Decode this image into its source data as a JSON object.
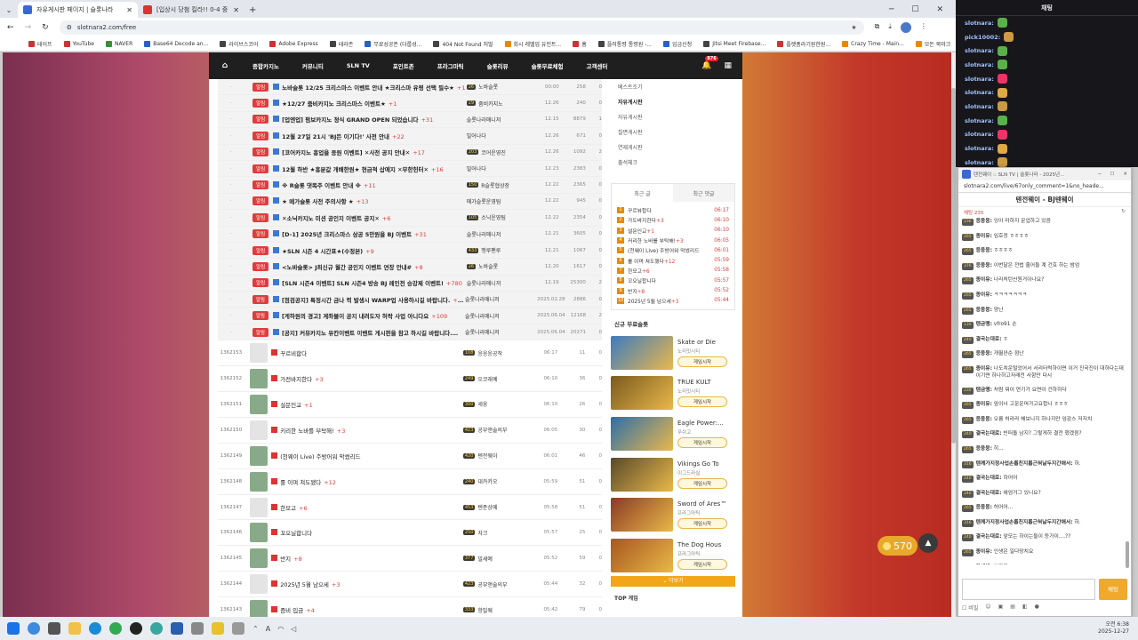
{
  "browser": {
    "tabs": [
      {
        "title": "자유게시판 페이지 | 슬롯나라",
        "active": true
      },
      {
        "title": "[입상시 당첨 킬라!! 0-4 중하드",
        "active": false
      }
    ],
    "url": "slotnara2.com/free",
    "bookmarks": [
      "테이프",
      "YouTube",
      "NAVER",
      "Base64 Decode an...",
      "라이브스코어",
      "Adobe Express",
      "테라존",
      "무료성공존 (다룹성...",
      "404 Not Found 처벌",
      "회시 레벨업 유인트...",
      "홈",
      "플러통령 통령원 -...",
      "입금신청",
      "Jitsi Meet Firebase...",
      "플랫폼라기원한원...",
      "Crazy Time - Main...",
      "모든 북마크"
    ]
  },
  "site": {
    "nav": [
      "종합카지노",
      "커뮤니티",
      "SLN TV",
      "포인트존",
      "프라그마틱",
      "슬롯리뷰",
      "슬롯무료체험",
      "고객센터"
    ],
    "bell_count": "876",
    "notice_label": "알림",
    "notices": [
      {
        "subject": "노바슬롯 12/25 크리스마스 이벤트 안내 ★크리스마 유령 선택 필수★",
        "comments": "+1",
        "lv": "26",
        "author": "노바슬롯",
        "date": "00:00",
        "views": "258",
        "likes": "0"
      },
      {
        "subject": "★12/27 줌비카지노 크리스마스 이벤트★",
        "comments": "+1",
        "lv": "29",
        "author": "줌비카지노",
        "date": "12.26",
        "views": "240",
        "likes": "0"
      },
      {
        "subject": "[업엔업] 펌보카지노 정식 GRAND OPEN 되었습니다",
        "comments": "+31",
        "lv": "",
        "author": "슬롯나라매니저",
        "date": "12.15",
        "views": "8879",
        "likes": "1"
      },
      {
        "subject": "12월 27일 21시 'BJ든 이기다!' 사전 안내",
        "comments": "+22",
        "lv": "",
        "author": "밀어나다",
        "date": "12.26",
        "views": "671",
        "likes": "0"
      },
      {
        "subject": "[코어카지노 흥업을 응원 이벤트] ✕사전 공지 안내✕",
        "comments": "+17",
        "lv": "203",
        "author": "코어운영진",
        "date": "12.26",
        "views": "1092",
        "likes": "2"
      },
      {
        "subject": "12월 하반 ★흥분값 개배한원★ 현금적 삽에지 ✕무한헌터✕",
        "comments": "+16",
        "lv": "",
        "author": "밀어나다",
        "date": "12.23",
        "views": "2383",
        "likes": "0"
      },
      {
        "subject": "※ R슬롯 댓목주 이벤트 안내 ※",
        "comments": "+11",
        "lv": "150",
        "author": "R슬롯협상장",
        "date": "12.22",
        "views": "2365",
        "likes": "0"
      },
      {
        "subject": "★ 메가슬롯 사전 주의사항 ★",
        "comments": "+13",
        "lv": "",
        "author": "메가슬롯운영팀",
        "date": "12.22",
        "views": "945",
        "likes": "0"
      },
      {
        "subject": "✕소닉카지노 미션 공인지 이벤트 공지✕",
        "comments": "+6",
        "lv": "105",
        "author": "소닉운영팀",
        "date": "12.22",
        "views": "2354",
        "likes": "0"
      },
      {
        "subject": "[D-1] 2025년 크리스마스 삼공 5만원을 BJ 이벤트",
        "comments": "+31",
        "lv": "",
        "author": "슬롯나라매니저",
        "date": "12.21",
        "views": "3605",
        "likes": "0"
      },
      {
        "subject": "★SLN 시즌 4 시간표★(수정본)",
        "comments": "+9",
        "lv": "433",
        "author": "맹루팬루",
        "date": "12.21",
        "views": "1067",
        "likes": "0"
      },
      {
        "subject": "<노바슬롯> J최신규 월간 공인지 이벤트 연장 안내#",
        "comments": "+8",
        "lv": "26",
        "author": "노바슬롯",
        "date": "12.20",
        "views": "1617",
        "likes": "0"
      },
      {
        "subject": "[SLN 시즌4 이벤트] SLN 시즌4 방송 BJ 레인전 승강제 이벤트!",
        "comments": "+780",
        "lv": "",
        "author": "슬롯나라매니저",
        "date": "12.19",
        "views": "25300",
        "likes": "2"
      },
      {
        "subject": "[점검공지] 특정시간 금나 력 발생시 WARP업 사용하시길 바랍니다.",
        "comments": "+34",
        "lv": "",
        "author": "슬롯나라매니저",
        "date": "2025.02.28",
        "views": "2886",
        "likes": "0"
      },
      {
        "subject": "[게하원의 경고] 계좌불이 공지 내려도자 허락 사업 아니다요",
        "comments": "+109",
        "lv": "",
        "author": "슬롯나라매니저",
        "date": "2025.06.04",
        "views": "12168",
        "likes": "2"
      },
      {
        "subject": "[공지] 커뮤카지노 유칸이벤트 이벤트 게시판을 참고 하시길 바랍니다.",
        "comments": "+22",
        "lv": "",
        "author": "슬롯나라매니저",
        "date": "2025.06.04",
        "views": "20271",
        "likes": "0"
      }
    ],
    "posts": [
      {
        "num": "1362153",
        "subject": "꾸르비합다",
        "comments": "",
        "lv": "108",
        "author": "응응응공작",
        "date": "06:17",
        "views": "11",
        "likes": "0"
      },
      {
        "num": "1362152",
        "subject": "가전바지한다",
        "comments": "+3",
        "lv": "249",
        "author": "오코래예",
        "date": "06:10",
        "views": "36",
        "likes": "0"
      },
      {
        "num": "1362151",
        "subject": "설문인교",
        "comments": "+1",
        "lv": "300",
        "author": "세웅",
        "date": "06:10",
        "views": "26",
        "likes": "0"
      },
      {
        "num": "1362150",
        "subject": "키리한 노바를 부탁해!",
        "comments": "+3",
        "lv": "423",
        "author": "공부앤술의부",
        "date": "06:05",
        "views": "30",
        "likes": "0"
      },
      {
        "num": "1362149",
        "subject": "(천웨이 Live) 주방어워 막썼리드",
        "comments": "",
        "lv": "420",
        "author": "텐전웨이",
        "date": "06:01",
        "views": "46",
        "likes": "0"
      },
      {
        "num": "1362148",
        "subject": "롤 이며 쳐도됐다",
        "comments": "+12",
        "lv": "240",
        "author": "대카카오",
        "date": "05:59",
        "views": "51",
        "likes": "0"
      },
      {
        "num": "1362147",
        "subject": "한모고",
        "comments": "+6",
        "lv": "453",
        "author": "텐준상메",
        "date": "05:58",
        "views": "51",
        "likes": "0"
      },
      {
        "num": "1362146",
        "subject": "꼬오닐합니다",
        "comments": "",
        "lv": "250",
        "author": "자크",
        "date": "05:57",
        "views": "25",
        "likes": "0"
      },
      {
        "num": "1362145",
        "subject": "반지",
        "comments": "+8",
        "lv": "377",
        "author": "밀셰예",
        "date": "05:52",
        "views": "59",
        "likes": "0"
      },
      {
        "num": "1362144",
        "subject": "2025년 5월 남으세",
        "comments": "+3",
        "lv": "423",
        "author": "공부앤술의부",
        "date": "05:44",
        "views": "32",
        "likes": "0"
      },
      {
        "num": "1362143",
        "subject": "즘비 입금",
        "comments": "+4",
        "lv": "333",
        "author": "항빌웨",
        "date": "05:42",
        "views": "79",
        "likes": "0"
      }
    ],
    "sidemenu": [
      "베스트조기",
      "자유게시판",
      "자유게시판",
      "칠면게시판",
      "연재게시판",
      "출석체크"
    ],
    "rank_tabs": [
      "최근 글",
      "최근 댓글"
    ],
    "rank": [
      {
        "n": "1",
        "t": "꾸르뷰합다",
        "c": "",
        "time": "06:17"
      },
      {
        "n": "2",
        "t": "가도바지한다",
        "c": "+3",
        "time": "06:10"
      },
      {
        "n": "3",
        "t": "설문인교",
        "c": "+1",
        "time": "06:10"
      },
      {
        "n": "4",
        "t": "커리한 노바를 부탁해!",
        "c": "+3",
        "time": "06:05"
      },
      {
        "n": "5",
        "t": "(천웨이 Live) 주방어워 막썼리드",
        "c": "",
        "time": "06:01"
      },
      {
        "n": "6",
        "t": "롤 이며 쳐도됐다",
        "c": "+12",
        "time": "05:59"
      },
      {
        "n": "7",
        "t": "한모고",
        "c": "+6",
        "time": "05:58"
      },
      {
        "n": "8",
        "t": "꼬오닐합니다",
        "c": "",
        "time": "05:57"
      },
      {
        "n": "9",
        "t": "반지",
        "c": "+8",
        "time": "05:52"
      },
      {
        "n": "10",
        "t": "2025년 5월 남으세",
        "c": "+3",
        "time": "05:44"
      }
    ],
    "games_header": "신규 무료슬롯",
    "games": [
      {
        "name": "Skate or Die",
        "provider": "노리밋시티",
        "button": "게임시작",
        "color": "#3d7bbf"
      },
      {
        "name": "TRUE KULT",
        "provider": "노리밋시티",
        "button": "게임시작",
        "color": "#7a5a1e"
      },
      {
        "name": "Eagle Power:...",
        "provider": "푸쉬고",
        "button": "게임시작",
        "color": "#2e6ea8"
      },
      {
        "name": "Vikings Go To",
        "provider": "이그드라실",
        "button": "게임시작",
        "color": "#5a4a2a"
      },
      {
        "name": "Sword of Ares™",
        "provider": "프라그마틱",
        "button": "게임시작",
        "color": "#8a3a22"
      },
      {
        "name": "The Dog Hous",
        "provider": "프라그마틱",
        "button": "게임시작",
        "color": "#a8561e"
      }
    ],
    "more_label": "더보기",
    "bottom_label": "TOP 게임",
    "coins": "570"
  },
  "chat": {
    "title": "채팅",
    "users": [
      "slotnara:",
      "pick10002:",
      "slotnara:",
      "slotnara:",
      "slotnara:",
      "slotnara:",
      "slotnara:",
      "slotnara:",
      "slotnara:",
      "slotnara:",
      "slotnara:"
    ]
  },
  "popup": {
    "title": "텐전웨이 :: SLN TV | 슬롯나라 - 2025년...",
    "url": "slotnara2.com/live/67only_comment=1&no_heade...",
    "name": "텐전웨이 - BJ텐웨이",
    "count": "채팅 235",
    "messages": [
      {
        "lv": "236",
        "nick": "응웅웅:",
        "text": "잉아 마하지 문업하고 있음"
      },
      {
        "lv": "265",
        "nick": "종이유:",
        "text": "임호정 ㅎㅎㅎㅎ"
      },
      {
        "lv": "265",
        "nick": "응웅웅:",
        "text": "ㅎㅎㅎㅎ"
      },
      {
        "lv": "376",
        "nick": "응웅웅:",
        "text": "이번달은 전법 줄어들 계 건호 하는 밤엄"
      },
      {
        "lv": "265",
        "nick": "종이유:",
        "text": "나라처턴신원거이나요?"
      },
      {
        "lv": "265",
        "nick": "종이유:",
        "text": "ㅋㅋㅋㅋㅋㅋㅋ"
      },
      {
        "lv": "265",
        "nick": "응웅웅:",
        "text": "양난"
      },
      {
        "lv": "130",
        "nick": "텐금맹:",
        "text": "vfro91 손"
      },
      {
        "lv": "240",
        "nick": "결국는대로:",
        "text": "ㅎ"
      },
      {
        "lv": "265",
        "nick": "응웅웅:",
        "text": "개월완순 점난"
      },
      {
        "lv": "265",
        "nick": "종이유:",
        "text": "나도치운털었어서 서리터럭하이면 이거 진국진이 대하다는데 이기면 하나하고저래전 사항만 다시"
      },
      {
        "lv": "230",
        "nick": "텐금맹:",
        "text": "처럼 뭐이 연기가 요면이 건하하다"
      },
      {
        "lv": "265",
        "nick": "종이유:",
        "text": "앞이너 고운운머가고요합니 ㅎㅎㅎ"
      },
      {
        "lv": "265",
        "nick": "응웅웅:",
        "text": "오름 허라라 해보니지 하나지만 임감스 저저치"
      },
      {
        "lv": "240",
        "nick": "결국는대로:",
        "text": "빈떠돌 남지? 그렇게하 결전 했겠음?"
      },
      {
        "lv": "265",
        "nick": "응웅웅:",
        "text": "히..."
      },
      {
        "lv": "316",
        "nick": "텐께가지정사업손롭친지롭근혀날두지간애서:",
        "text": "하."
      },
      {
        "lv": "240",
        "nick": "결국는대로:",
        "text": "하어어"
      },
      {
        "lv": "240",
        "nick": "결국는대로:",
        "text": "헤엄거그 있니요?"
      },
      {
        "lv": "265",
        "nick": "응웅웅:",
        "text": "허어어..."
      },
      {
        "lv": "316",
        "nick": "텐께가지정사업손롭친지롭근혀날두지간애서:",
        "text": "하."
      },
      {
        "lv": "240",
        "nick": "결국는대로:",
        "text": "앞모는 하이는들이 등가이....??"
      },
      {
        "lv": "265",
        "nick": "종이유:",
        "text": "인생은 일다망치요"
      },
      {
        "lv": "116",
        "nick": "자세예:",
        "text": "업무원"
      }
    ],
    "send": "채팅",
    "tools": [
      "비밀"
    ]
  },
  "taskbar": {
    "time": "오전 6:38",
    "date": "2025-12-27"
  }
}
